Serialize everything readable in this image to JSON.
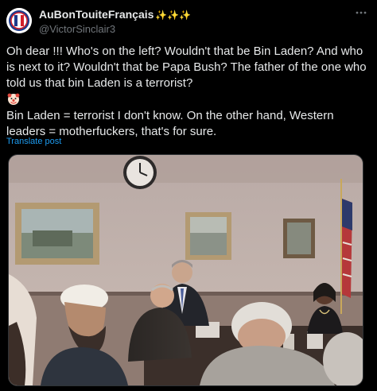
{
  "post": {
    "author_name": "AuBonTouiteFrançais",
    "author_name_emoji": "✨✨✨",
    "author_handle": "@VictorSinclair3",
    "more_icon": "ellipsis-icon",
    "text_line1": "Oh dear !!! Who's on the left? Wouldn't that be Bin Laden? And who is next to it? Wouldn't that be Papa Bush? The father of the one who told us that bin Laden is a terrorist?",
    "emoji_icon": "clown-face-icon",
    "text_line2": "Bin Laden = terrorist I don't know. On the other hand, Western leaders = motherfuckers, that's for sure.",
    "translate_label": "Translate post"
  },
  "colors": {
    "background": "#000000",
    "text": "#e7e9ea",
    "secondary": "#71767b",
    "link": "#1d9bf0"
  }
}
